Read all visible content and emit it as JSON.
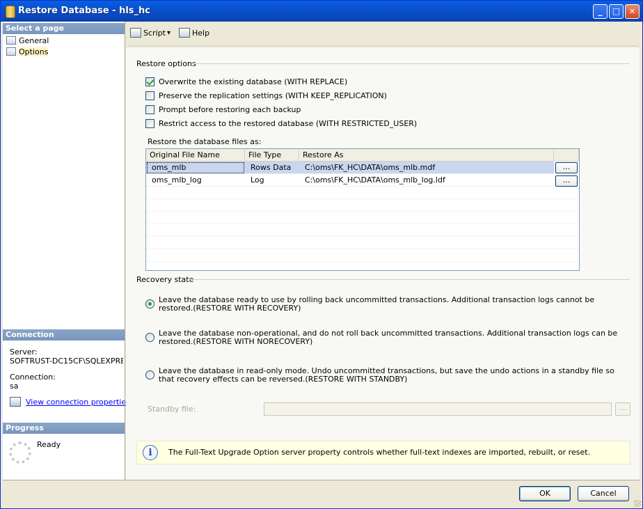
{
  "window": {
    "title": "Restore Database - hls_hc",
    "minimize": "_",
    "maximize": "□",
    "close": "✕"
  },
  "left": {
    "select_page_header": "Select a page",
    "pages": [
      {
        "label": "General",
        "selected": false
      },
      {
        "label": "Options",
        "selected": true
      }
    ],
    "connection_header": "Connection",
    "server_label": "Server:",
    "server_value": "SOFTRUST-DC15CF\\SQLEXPRE",
    "connection_label": "Connection:",
    "connection_value": "sa",
    "view_connection_link": "View connection properties",
    "progress_header": "Progress",
    "progress_status": "Ready"
  },
  "toolbar": {
    "script_label": "Script",
    "script_dropdown_icon": "▾",
    "help_label": "Help"
  },
  "restore_options": {
    "group_label": "Restore options",
    "checkboxes": [
      {
        "label": "Overwrite the existing database (WITH REPLACE)",
        "checked": true
      },
      {
        "label": "Preserve the replication settings (WITH KEEP_REPLICATION)",
        "checked": false
      },
      {
        "label": "Prompt before restoring each backup",
        "checked": false
      },
      {
        "label": "Restrict access to the restored database (WITH RESTRICTED_USER)",
        "checked": false
      }
    ],
    "files_label": "Restore the database files as:",
    "columns": [
      "Original File Name",
      "File Type",
      "Restore As"
    ],
    "rows": [
      {
        "original": "oms_mlb",
        "type": "Rows Data",
        "restore_as": "C:\\oms\\FK_HC\\DATA\\oms_mlb.mdf",
        "browse": "...",
        "selected": true
      },
      {
        "original": "oms_mlb_log",
        "type": "Log",
        "restore_as": "C:\\oms\\FK_HC\\DATA\\oms_mlb_log.ldf",
        "browse": "...",
        "selected": false
      }
    ]
  },
  "recovery": {
    "group_label": "Recovery state",
    "options": [
      {
        "label": "Leave the database ready to use by rolling back uncommitted transactions. Additional transaction logs cannot be restored.(RESTORE WITH RECOVERY)",
        "selected": true
      },
      {
        "label": "Leave the database non-operational, and do not roll back uncommitted transactions. Additional transaction logs can be restored.(RESTORE WITH NORECOVERY)",
        "selected": false
      },
      {
        "label": "Leave the database in read-only mode. Undo uncommitted transactions, but save the undo actions in a standby file so that recovery effects can be reversed.(RESTORE WITH STANDBY)",
        "selected": false
      }
    ],
    "standby_label": "Standby file:",
    "standby_value": "",
    "standby_browse": "..."
  },
  "info": {
    "icon": "i",
    "text": "The Full-Text Upgrade Option server property controls whether full-text indexes are imported, rebuilt, or reset."
  },
  "buttons": {
    "ok": "OK",
    "cancel": "Cancel"
  },
  "colors": {
    "title_bar": "#0A5FE0",
    "section_header": "#7996BE",
    "selected_row": "#C8D6F0",
    "check_green": "#21A121",
    "info_bg": "#FFFFE1"
  }
}
